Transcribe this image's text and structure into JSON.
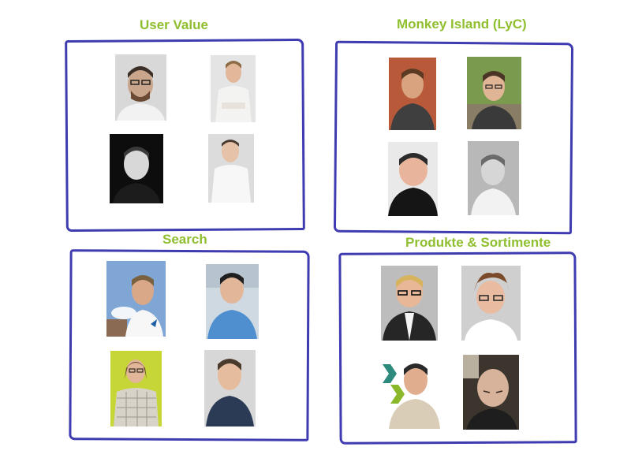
{
  "teams": [
    {
      "title": "User Value"
    },
    {
      "title": "Monkey Island (LyC)"
    },
    {
      "title": "Search"
    },
    {
      "title": "Produkte & Sortimente"
    }
  ],
  "colors": {
    "title_green": "#8fbf2f",
    "box_stroke": "#3f3bb0"
  }
}
